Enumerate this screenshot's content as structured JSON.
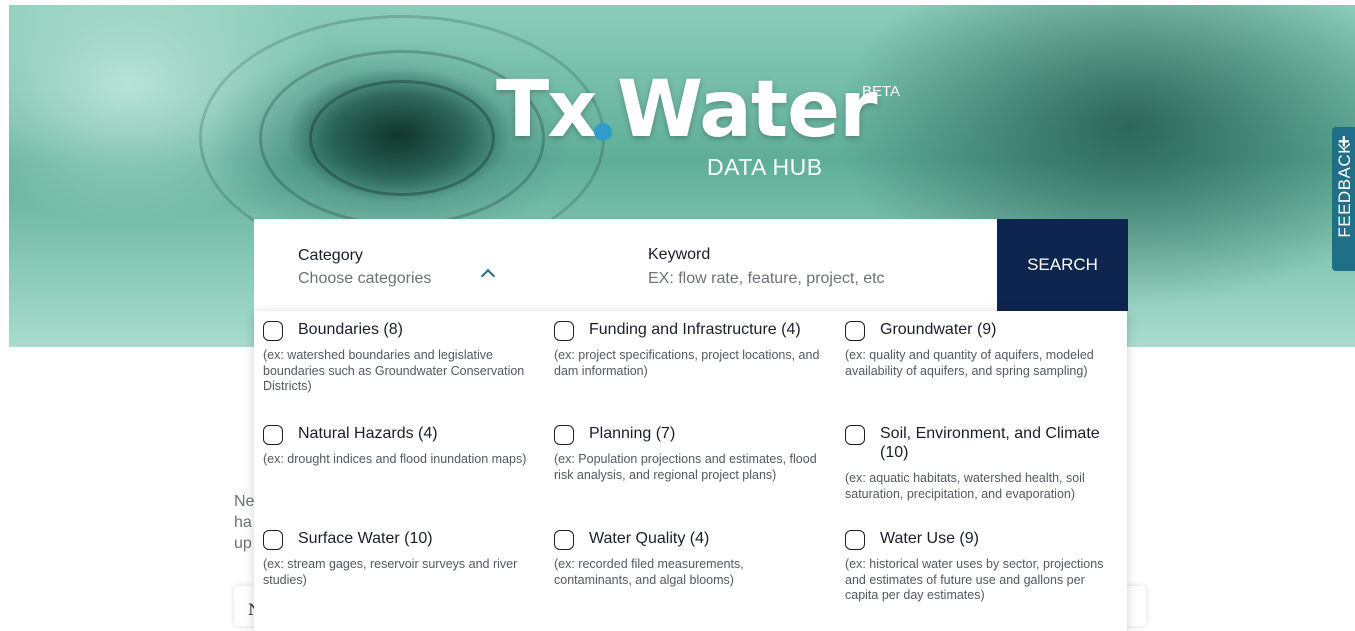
{
  "header": {
    "logo_tx": "Tx",
    "logo_water": "Water",
    "beta_label": "BETA",
    "subtitle": "DATA HUB"
  },
  "feedback": {
    "label": "FEEDBACK",
    "icon": "plus-icon"
  },
  "search": {
    "category_label": "Category",
    "category_placeholder": "Choose categories",
    "keyword_label": "Keyword",
    "keyword_placeholder": "EX: flow rate, feature, project, etc",
    "button_label": "SEARCH"
  },
  "background_text": {
    "line1": "Ne",
    "line2": "ha",
    "line3": "up",
    "card_letter": "N"
  },
  "categories": [
    {
      "title": "Boundaries (8)",
      "desc": "(ex: watershed boundaries and legislative boundaries such as Groundwater Conservation Districts)",
      "checked": false
    },
    {
      "title": "Funding and Infrastructure (4)",
      "desc": "(ex: project specifications, project locations, and dam information)",
      "checked": false
    },
    {
      "title": "Groundwater (9)",
      "desc": "(ex: quality and quantity of aquifers, modeled availability of aquifers, and spring sampling)",
      "checked": false
    },
    {
      "title": "Natural Hazards (4)",
      "desc": "(ex: drought indices and flood inundation maps)",
      "checked": false
    },
    {
      "title": "Planning (7)",
      "desc": "(ex: Population projections and estimates, flood risk analysis, and regional project plans)",
      "checked": false
    },
    {
      "title": "Soil, Environment, and Climate (10)",
      "desc": "(ex: aquatic habitats, watershed health, soil saturation, precipitation, and evaporation)",
      "checked": false
    },
    {
      "title": "Surface Water (10)",
      "desc": "(ex: stream gages, reservoir surveys and river studies)",
      "checked": false
    },
    {
      "title": "Water Quality (4)",
      "desc": "(ex: recorded filed measurements, contaminants, and algal blooms)",
      "checked": false
    },
    {
      "title": "Water Use (9)",
      "desc": "(ex: historical water uses by sector, projections and estimates of future use and gallons per capita per day estimates)",
      "checked": false
    }
  ],
  "colors": {
    "navy": "#0e2550",
    "teal": "#1f6f89",
    "dot_blue": "#2f9cc9"
  }
}
